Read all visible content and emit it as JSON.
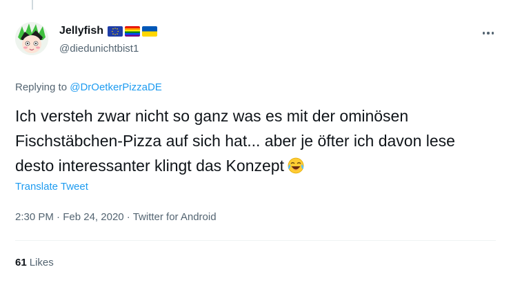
{
  "tweet": {
    "author": {
      "display_name": "Jellyfish",
      "handle": "@diedunichtbist1",
      "name_flags": [
        "eu-flag-icon",
        "rainbow-flag-icon",
        "ukraine-flag-icon"
      ]
    },
    "reply_prefix": "Replying to",
    "reply_to": "@DrOetkerPizzaDE",
    "text": "Ich versteh zwar nicht so ganz was es mit der ominösen Fischstäbchen-Pizza auf sich hat... aber je öfter ich davon lese desto interessanter klingt das Konzept",
    "emoji": "face-with-tears-of-joy-icon",
    "translate_label": "Translate Tweet",
    "time": "2:30 PM",
    "separator": " · ",
    "date": "Feb 24, 2020",
    "source": "Twitter for Android",
    "likes_count": "61",
    "likes_label": "Likes"
  },
  "colors": {
    "text": "#0f1419",
    "secondary": "#536471",
    "link": "#1d9bf0",
    "divider": "#eff3f4"
  }
}
